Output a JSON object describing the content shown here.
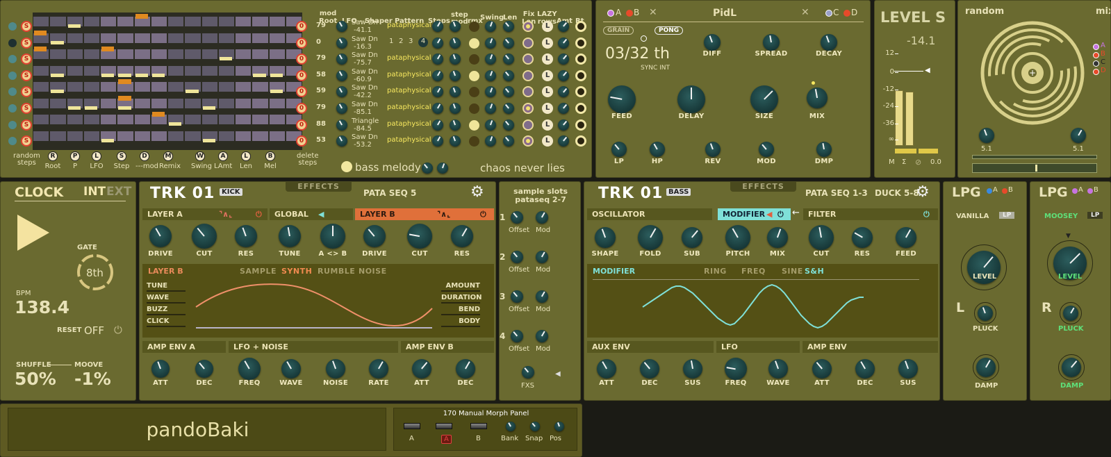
{
  "sequencer": {
    "col_mod_root": "mod\nRoot",
    "col_lfo": "LFO - Shaper",
    "col_pattern": "Pattern",
    "col_steps": "Steps",
    "col_step_mod": "step\nmod",
    "col_rmx": "rmx",
    "col_swing": "Swing",
    "col_len": "Len",
    "col_fix_len": "Fix\nLen",
    "col_lazy_rows": "LAZY\nrows",
    "col_amt": "Amt",
    "col_rt": "Rt",
    "rows": [
      {
        "root": "79",
        "lfo_shape": "Saw Dn",
        "lfo_value": "-41.1",
        "pattern": "pataphysical"
      },
      {
        "root": "0",
        "lfo_shape": "Saw Dn",
        "lfo_value": "-16.3",
        "pattern": "1 2 3 4"
      },
      {
        "root": "79",
        "lfo_shape": "Saw Dn",
        "lfo_value": "-75.7",
        "pattern": "pataphysical"
      },
      {
        "root": "58",
        "lfo_shape": "Saw Dn",
        "lfo_value": "-60.9",
        "pattern": "pataphysical"
      },
      {
        "root": "59",
        "lfo_shape": "Saw Dn",
        "lfo_value": "-42.2",
        "pattern": "pataphysical"
      },
      {
        "root": "79",
        "lfo_shape": "Saw Dn",
        "lfo_value": "-85.1",
        "pattern": "pataphysical"
      },
      {
        "root": "88",
        "lfo_shape": "Triangle",
        "lfo_value": "-84.5",
        "pattern": "pataphysical"
      },
      {
        "root": "53",
        "lfo_shape": "Saw Dn",
        "lfo_value": "-53.2",
        "pattern": "pataphysical"
      }
    ],
    "pattern_steps": [
      "1",
      "2",
      "3",
      "4"
    ],
    "row_s_label": "S",
    "row_zero": "0",
    "lazy_L": "L",
    "bottom_buttons": [
      {
        "letter": "R",
        "label": "Root"
      },
      {
        "letter": "P",
        "label": "P"
      },
      {
        "letter": "L",
        "label": "LFO"
      },
      {
        "letter": "S",
        "label": "Step"
      },
      {
        "letter": "D",
        "label": "---mod"
      },
      {
        "letter": "M",
        "label": "Remix"
      },
      {
        "letter": "W",
        "label": "Swing"
      },
      {
        "letter": "A",
        "label": "LAmt"
      },
      {
        "letter": "L",
        "label": "Len"
      },
      {
        "letter": "B",
        "label": "Mel"
      }
    ],
    "random_steps": "random\nsteps",
    "delete_steps": "delete\nsteps",
    "bass_melody": "bass melody",
    "chaos": "chaos never lies"
  },
  "pidl": {
    "title": "PidL",
    "a": "A",
    "b": "B",
    "c": "C",
    "d": "D",
    "x": "✕",
    "grain": "GRAIN",
    "pong": "PONG",
    "time": "03/32 th",
    "sync": "SYNC INT",
    "top_knobs": [
      "DIFF",
      "SPREAD",
      "DECAY"
    ],
    "mid_knobs": [
      "FEED",
      "DELAY",
      "SIZE",
      "MIX"
    ],
    "bot_knobs": [
      "LP",
      "HP",
      "REV",
      "MOD",
      "DMP"
    ]
  },
  "level": {
    "title": "LEVEL S",
    "value": "-14.1",
    "scale": [
      "12",
      "0",
      "-12",
      "-24",
      "-36",
      "∞"
    ],
    "m": "M",
    "sigma": "Σ",
    "zero": "0.0"
  },
  "random": {
    "title": "random",
    "mix": "mix",
    "abcd": [
      "A",
      "B",
      "C",
      "D"
    ],
    "v1": "5.1",
    "v2": "5.1"
  },
  "clock": {
    "title": "CLOCK",
    "int": "INT",
    "ext": "EXT",
    "gate_label": "GATE",
    "gate_value": "8th",
    "bpm_label": "BPM",
    "bpm": "138.4",
    "reset": "RESET",
    "reset_state": "OFF",
    "shuffle_label": "SHUFFLE",
    "shuffle": "50%",
    "moove_label": "MOOVE",
    "moove": "-1%"
  },
  "kick": {
    "logo": "TRK 01",
    "badge": "KICK",
    "effects": "EFFECTS",
    "preset": "PATA SEQ 5",
    "layer_a": "LAYER A",
    "global": "GLOBAL",
    "layer_b": "LAYER B",
    "knobs_a": [
      "DRIVE",
      "CUT",
      "RES"
    ],
    "knobs_g": [
      "TUNE",
      "A <> B"
    ],
    "knobs_b": [
      "DRIVE",
      "CUT",
      "RES"
    ],
    "layer_b_tab": "LAYER B",
    "tabs": [
      "SAMPLE",
      "SYNTH",
      "RUMBLE",
      "NOISE"
    ],
    "params_left": [
      "TUNE",
      "WAVE",
      "BUZZ",
      "CLICK"
    ],
    "params_right": [
      "AMOUNT",
      "DURATION",
      "BEND",
      "BODY"
    ],
    "amp_env_a": "AMP ENV A",
    "lfo_noise": "LFO + NOISE",
    "amp_env_b": "AMP ENV B",
    "bottom_knobs": [
      "ATT",
      "DEC",
      "FREQ",
      "WAVE",
      "NOISE",
      "RATE",
      "ATT",
      "DEC"
    ]
  },
  "slots": {
    "title": "sample slots\npataseq 2-7",
    "nums": [
      "1",
      "2",
      "3",
      "4"
    ],
    "offset": "Offset",
    "mod": "Mod",
    "fxs": "FXS"
  },
  "bass": {
    "logo": "TRK 01",
    "badge": "BASS",
    "effects": "EFFECTS",
    "preset1": "PATA SEQ 1-3",
    "preset2": "DUCK 5-8",
    "oscillator": "OSCILLATOR",
    "modifier": "MODIFIER",
    "filter": "FILTER",
    "knobs_osc": [
      "SHAPE",
      "FOLD",
      "SUB"
    ],
    "knobs_mod": [
      "PITCH",
      "MIX"
    ],
    "knobs_fil": [
      "CUT",
      "RES",
      "FEED"
    ],
    "mod_tab": "MODIFIER",
    "tabs": [
      "RING",
      "FREQ",
      "SINE",
      "S&H"
    ],
    "aux_env": "AUX ENV",
    "lfo": "LFO",
    "amp_env": "AMP ENV",
    "bottom_knobs": [
      "ATT",
      "DEC",
      "SUS",
      "FREQ",
      "WAVE",
      "ATT",
      "DEC",
      "SUS"
    ]
  },
  "lpg_l": {
    "title": "LPG",
    "a": "A",
    "b": "B",
    "name": "VANILLA",
    "mode": "LP",
    "side": "L",
    "level": "LEVEL",
    "pluck": "PLUCK",
    "damp": "DAMP"
  },
  "lpg_r": {
    "title": "LPG",
    "a": "A",
    "b": "B",
    "name": "MOOSEY",
    "mode": "LP",
    "side": "R",
    "level": "LEVEL",
    "pluck": "PLUCK",
    "damp": "DAMP"
  },
  "footer": {
    "name": "pandoBaki",
    "morph_title": "170 Manual Morph Panel",
    "slots": [
      "A",
      "A",
      "B"
    ],
    "knobs": [
      "Bank",
      "Snap",
      "Pos"
    ]
  },
  "colors": {
    "panel": "#6a6a30",
    "knob": "#1f4a4a",
    "accent_orange": "#e0703a",
    "accent_cyan": "#7fe0d8",
    "yellow": "#f7e85f"
  }
}
